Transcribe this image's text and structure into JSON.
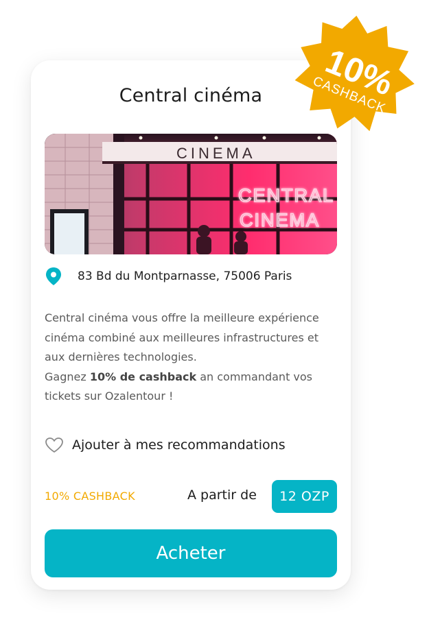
{
  "card": {
    "title": "Central cinéma",
    "address": "83 Bd du Montparnasse, 75006 Paris",
    "description": {
      "line1": "Central cinéma vous offre la meilleure expérience cinéma combiné aux meilleures infrastructures et aux dernières technologies.",
      "line2_prefix": "Gagnez ",
      "line2_bold": "10% de cashback",
      "line2_suffix": " an commandant vos tickets sur Ozalentour !"
    },
    "recommend_label": "Ajouter à mes recommandations",
    "cashback_label": "10% CASHBACK",
    "from_label": "A partir de",
    "price": "12 OZP",
    "buy_label": "Acheter"
  },
  "photo": {
    "sign_text": "CINEMA",
    "neon_line1": "CENTRAL",
    "neon_line2": "CINEMA"
  },
  "badge": {
    "percent": "10%",
    "text": "CASHBACK"
  },
  "colors": {
    "accent": "#05b4c6",
    "cashback": "#f2a900",
    "badge": "#f2a900",
    "neon": "#ff2d7a"
  },
  "icons": {
    "pin": "map-pin-icon",
    "heart": "heart-outline-icon"
  }
}
